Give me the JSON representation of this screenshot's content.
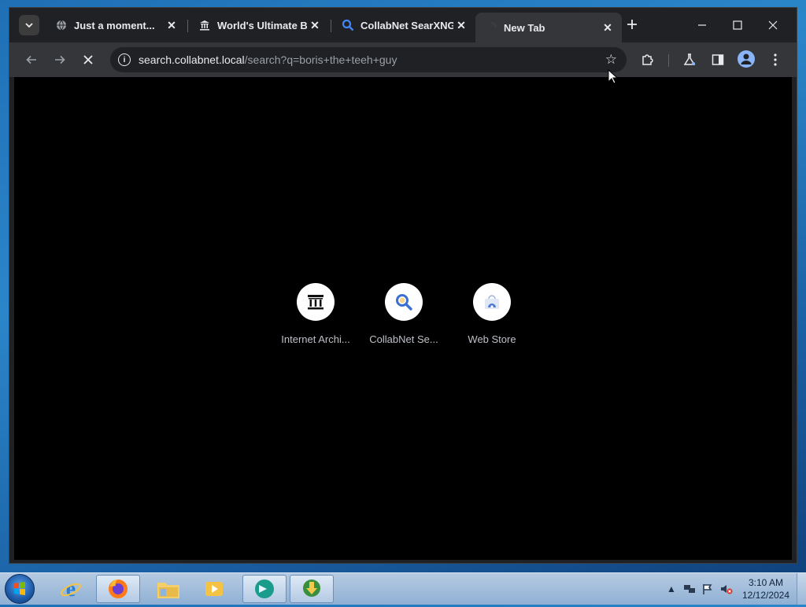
{
  "browser": {
    "tabs": [
      {
        "title": "Just a moment...",
        "icon": "globe-icon"
      },
      {
        "title": "World's Ultimate Bu",
        "icon": "museum-icon"
      },
      {
        "title": "CollabNet SearXNG",
        "icon": "search-icon"
      },
      {
        "title": "New Tab",
        "icon": "loading-icon",
        "active": true
      }
    ],
    "url_host": "search.collabnet.local",
    "url_path": "/search?q=boris+the+teeh+guy",
    "info_glyph": "i"
  },
  "newtab": {
    "shortcuts": [
      {
        "label": "Internet Archi...",
        "icon": "museum-icon"
      },
      {
        "label": "CollabNet Se...",
        "icon": "search-icon"
      },
      {
        "label": "Web Store",
        "icon": "web-store-icon"
      }
    ]
  },
  "taskbar": {
    "apps": [
      "internet-explorer-icon",
      "firefox-icon",
      "file-explorer-icon",
      "media-player-icon",
      "app-globe-icon",
      "download-manager-icon"
    ],
    "time": "3:10 AM",
    "date": "12/12/2024"
  },
  "colors": {
    "content_bg": "#000000",
    "toolbar_bg": "#35363a",
    "accent_blue": "#8ab4f8"
  }
}
